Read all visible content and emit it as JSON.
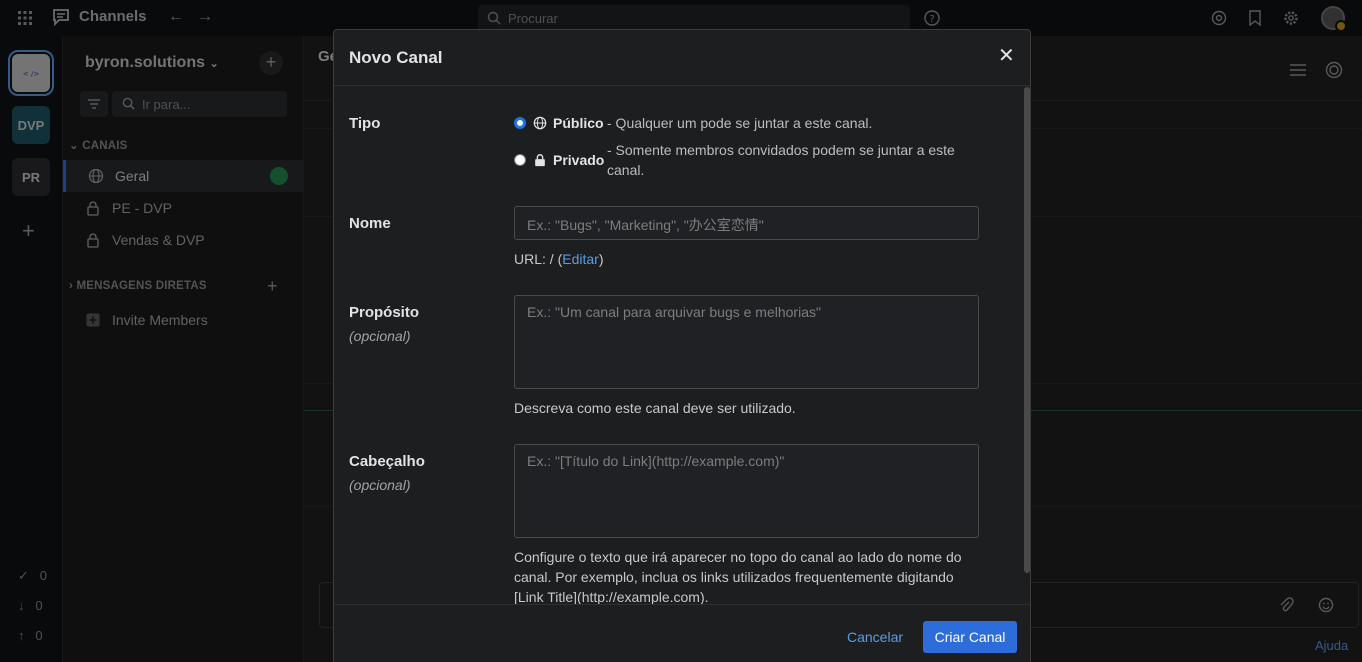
{
  "topbar": {
    "app_name": "Channels",
    "search_placeholder": "Procurar"
  },
  "teams": [
    {
      "label": "",
      "color": "#c9c9c9"
    },
    {
      "label": "DVP",
      "color": "#1c5564"
    },
    {
      "label": "PR",
      "color": "#2b2c2f"
    }
  ],
  "counters": [
    "0",
    "0",
    "0"
  ],
  "sidebar": {
    "team_name": "byron.solutions",
    "jump_placeholder": "Ir para...",
    "channels_section": "CANAIS",
    "channels": [
      {
        "name": "Geral",
        "icon": "globe-icon"
      },
      {
        "name": "PE - DVP",
        "icon": "lock-icon"
      },
      {
        "name": "Vendas & DVP",
        "icon": "lock-icon"
      }
    ],
    "dm_section": "MENSAGENS DIRETAS",
    "invite": "Invite Members"
  },
  "center": {
    "header_partial": "Ge",
    "help_link": "Ajuda"
  },
  "modal": {
    "title": "Novo Canal",
    "type_label": "Tipo",
    "public_title": "Público",
    "public_desc": "- Qualquer um pode se juntar a este canal.",
    "private_title": "Privado",
    "private_desc": "- Somente membros convidados podem se juntar a este canal.",
    "name_label": "Nome",
    "name_placeholder": "Ex.: \"Bugs\", \"Marketing\", \"办公室恋情\"",
    "url_prefix": "URL: / (",
    "url_edit": "Editar",
    "url_suffix": ")",
    "purpose_label": "Propósito",
    "optional": "(opcional)",
    "purpose_placeholder": "Ex.: \"Um canal para arquivar bugs e melhorias\"",
    "purpose_help": "Descreva como este canal deve ser utilizado.",
    "header_label": "Cabeçalho",
    "header_placeholder": "Ex.: \"[Título do Link](http://example.com)\"",
    "header_help": "Configure o texto que irá aparecer no topo do canal ao lado do nome do canal. Por exemplo, inclua os links utilizados frequentemente digitando [Link Title](http://example.com).",
    "cancel_label": "Cancelar",
    "create_label": "Criar Canal"
  }
}
